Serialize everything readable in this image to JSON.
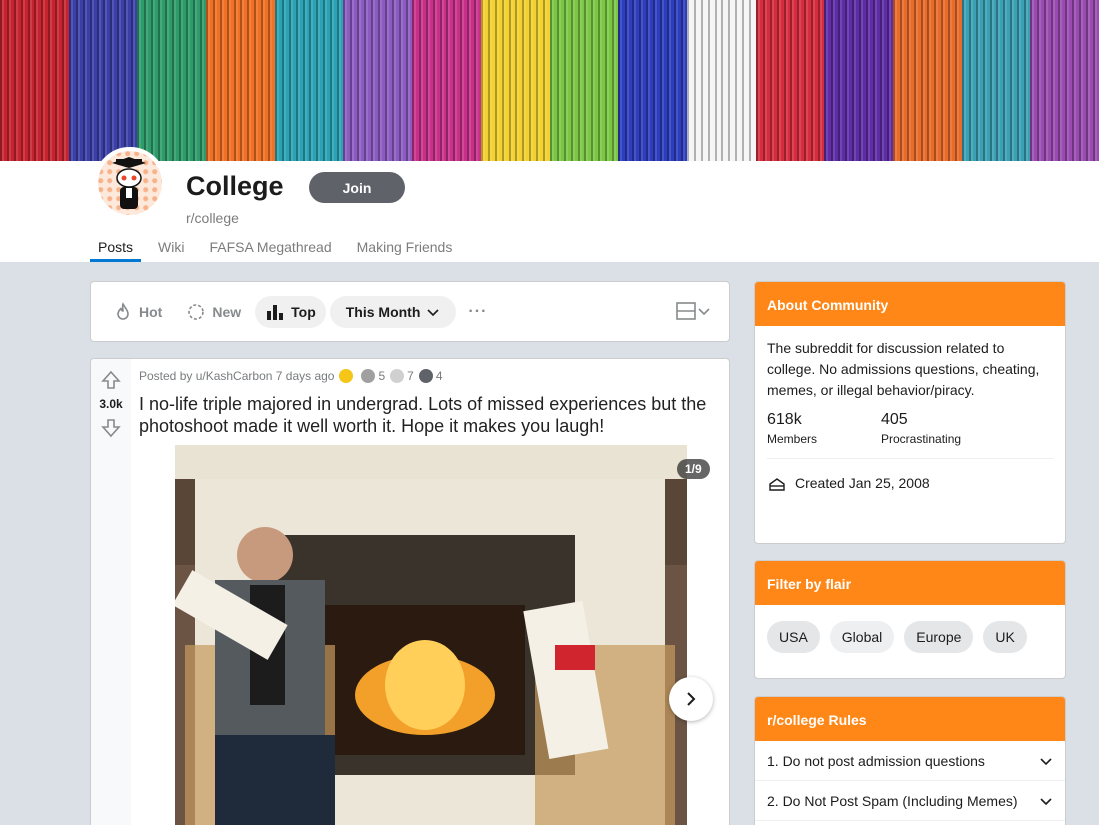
{
  "banner": {
    "colors": [
      "#c7232f",
      "#3b3fa8",
      "#2d9c6a",
      "#f07024",
      "#2aa3b5",
      "#8b5bc2",
      "#c8308a",
      "#f3d130",
      "#7bc744",
      "#2c3dbd",
      "#f5f5f5",
      "#d62c3e",
      "#5e2ca5",
      "#e86b29",
      "#3aa0b4",
      "#9a4bb0"
    ]
  },
  "subreddit": {
    "title": "College",
    "name": "r/college",
    "join_label": "Join",
    "tabs": [
      "Posts",
      "Wiki",
      "FAFSA Megathread",
      "Making Friends"
    ]
  },
  "sortbar": {
    "hot": "Hot",
    "new": "New",
    "top": "Top",
    "period": "This Month",
    "more": "···"
  },
  "post": {
    "votes": "3.0k",
    "posted_by": "Posted by u/KashCarbon",
    "age": "7 days ago",
    "awards": [
      {
        "count": "",
        "color": "#f5c518"
      },
      {
        "count": "5",
        "color": "#a0a0a0"
      },
      {
        "count": "7",
        "color": "#d0d0d0"
      },
      {
        "count": "4",
        "color": "#5f6369"
      }
    ],
    "title": "I no-life triple majored in undergrad. Lots of missed experiences but the photoshoot made it well worth it. Hope it makes you laugh!",
    "image_counter": "1/9"
  },
  "about": {
    "heading": "About Community",
    "description": "The subreddit for discussion related to college. No admissions questions, cheating, memes, or illegal behavior/piracy.",
    "members_count": "618k",
    "members_label": "Members",
    "online_count": "405",
    "online_label": "Procrastinating",
    "created": "Created Jan 25, 2008"
  },
  "flair": {
    "heading": "Filter by flair",
    "items": [
      "USA",
      "Global",
      "Europe",
      "UK"
    ]
  },
  "rules": {
    "heading": "r/college Rules",
    "items": [
      "1. Do not post admission questions",
      "2. Do Not Post Spam (Including Memes)"
    ]
  },
  "colors": {
    "accent": "#ff8717",
    "join": "#5f6369",
    "tab_active": "#0079d3"
  }
}
